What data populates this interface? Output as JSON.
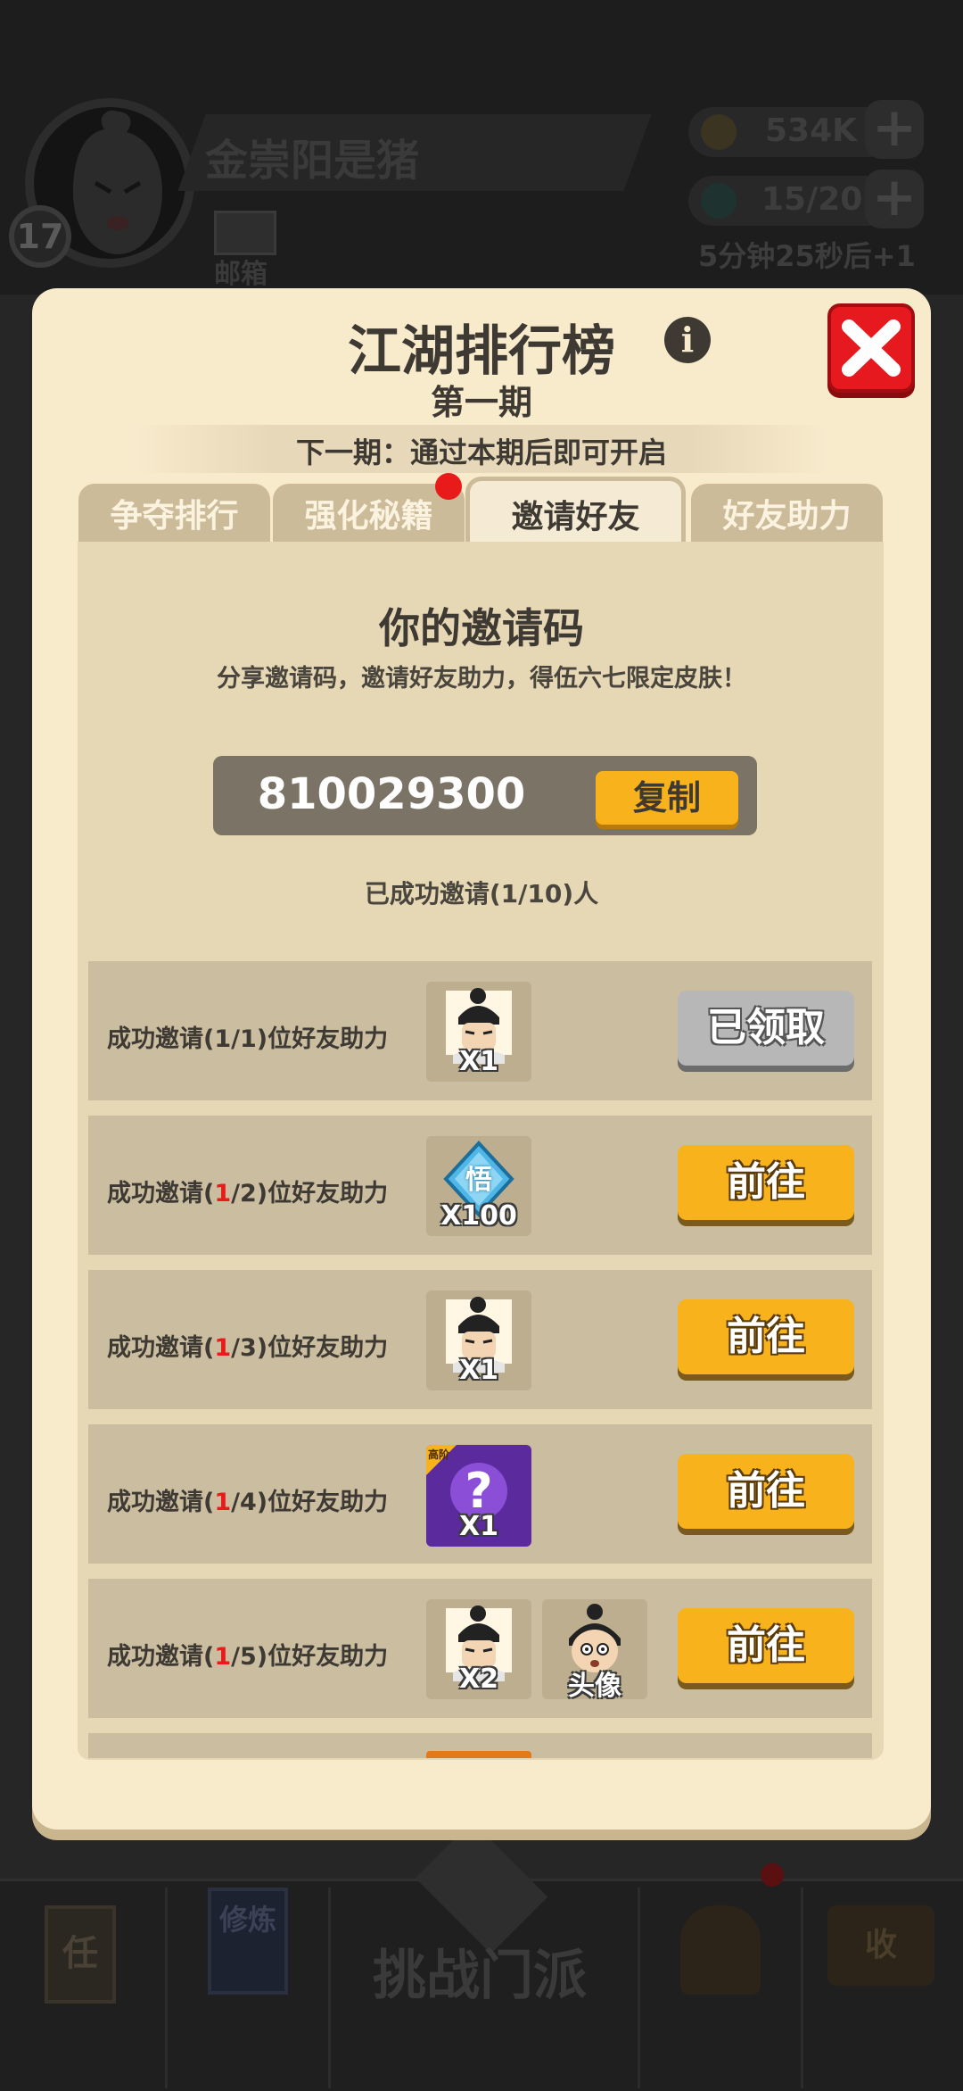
{
  "background": {
    "player_name": "金崇阳是猪",
    "level": "17",
    "mail_label": "邮箱",
    "gold": "534K",
    "energy": "15/20",
    "timer": "5分钟25秒后+1",
    "challenge_label": "挑战门派",
    "bottom_icons": [
      "任",
      "修炼",
      "收"
    ]
  },
  "modal": {
    "title": "江湖排行榜",
    "subtitle": "第一期",
    "next_period": "下一期：通过本期后即可开启",
    "tabs": [
      {
        "label": "争夺排行"
      },
      {
        "label": "强化秘籍"
      },
      {
        "label": "邀请好友"
      },
      {
        "label": "好友助力"
      }
    ],
    "invite": {
      "title": "你的邀请码",
      "description": "分享邀请码，邀请好友助力，得伍六七限定皮肤！",
      "code": "810029300",
      "copy_label": "复制",
      "invited_status": "已成功邀请(1/10)人"
    },
    "rewards": [
      {
        "label_prefix": "成功邀请(",
        "progress": "1",
        "label_suffix": "/1)位好友助力",
        "progress_red": false,
        "items": [
          {
            "icon": "character-portrait",
            "qty": "X1"
          }
        ],
        "button": "已领取",
        "claimed": true
      },
      {
        "label_prefix": "成功邀请(",
        "progress": "1",
        "label_suffix": "/2)位好友助力",
        "progress_red": true,
        "items": [
          {
            "icon": "blue-diamond-wu",
            "qty": "X100",
            "glyph": "悟"
          }
        ],
        "button": "前往",
        "claimed": false
      },
      {
        "label_prefix": "成功邀请(",
        "progress": "1",
        "label_suffix": "/3)位好友助力",
        "progress_red": true,
        "items": [
          {
            "icon": "character-portrait",
            "qty": "X1"
          }
        ],
        "button": "前往",
        "claimed": false
      },
      {
        "label_prefix": "成功邀请(",
        "progress": "1",
        "label_suffix": "/4)位好友助力",
        "progress_red": true,
        "items": [
          {
            "icon": "mystery-box",
            "qty": "X1",
            "tag": "高阶"
          }
        ],
        "button": "前往",
        "claimed": false
      },
      {
        "label_prefix": "成功邀请(",
        "progress": "1",
        "label_suffix": "/5)位好友助力",
        "progress_red": true,
        "items": [
          {
            "icon": "character-portrait",
            "qty": "X2"
          },
          {
            "icon": "avatar-head",
            "qty": "头像"
          }
        ],
        "button": "前往",
        "claimed": false
      }
    ]
  },
  "colors": {
    "modal_bg": "#f8ebcc",
    "accent_orange": "#f7b21c",
    "close_red": "#e6191e"
  }
}
